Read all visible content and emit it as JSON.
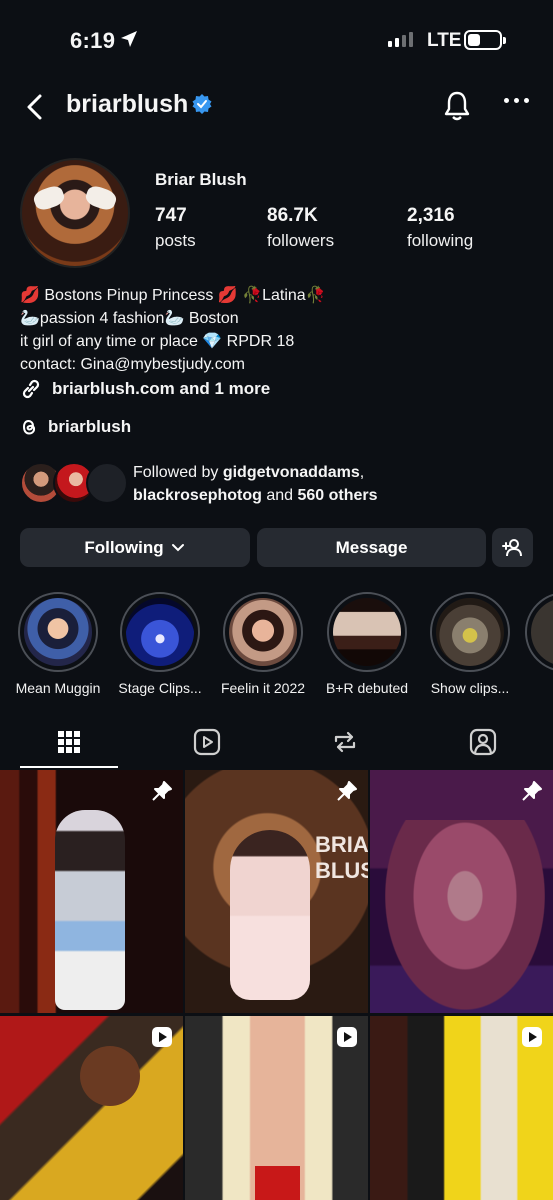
{
  "status_bar": {
    "time": "6:19",
    "network": "LTE"
  },
  "header": {
    "username": "briarblush",
    "icons": [
      "back-chevron-icon",
      "verified-badge-icon",
      "bell-icon",
      "more-icon"
    ]
  },
  "profile": {
    "display_name": "Briar Blush",
    "stats": [
      {
        "value": "747",
        "label": "posts"
      },
      {
        "value": "86.7K",
        "label": "followers"
      },
      {
        "value": "2,316",
        "label": "following"
      }
    ],
    "bio": [
      "💋 Bostons Pinup Princess 💋 🥀Latina🥀",
      "🦢passion 4 fashion🦢 Boston",
      "it girl of any time or place 💎 RPDR 18",
      "contact: Gina@mybestjudy.com"
    ],
    "link": "briarblush.com and 1 more",
    "threads": "briarblush"
  },
  "followed_by": {
    "prefix": "Followed by ",
    "user1": "gidgetvonaddams",
    "comma": ",",
    "user2": "blackrosephotog",
    "and": " and ",
    "others": "560 others"
  },
  "actions": {
    "following_label": "Following",
    "message_label": "Message"
  },
  "highlights": [
    {
      "label": "Mean Muggin"
    },
    {
      "label": "Stage Clips..."
    },
    {
      "label": "Feelin it 2022"
    },
    {
      "label": "B+R debuted"
    },
    {
      "label": "Show clips..."
    }
  ],
  "tabs": [
    "grid-icon",
    "reels-icon",
    "reposts-icon",
    "tagged-icon"
  ],
  "colors": {
    "background": "#0c0f14",
    "verified": "#3897f0",
    "button": "#262a31"
  }
}
